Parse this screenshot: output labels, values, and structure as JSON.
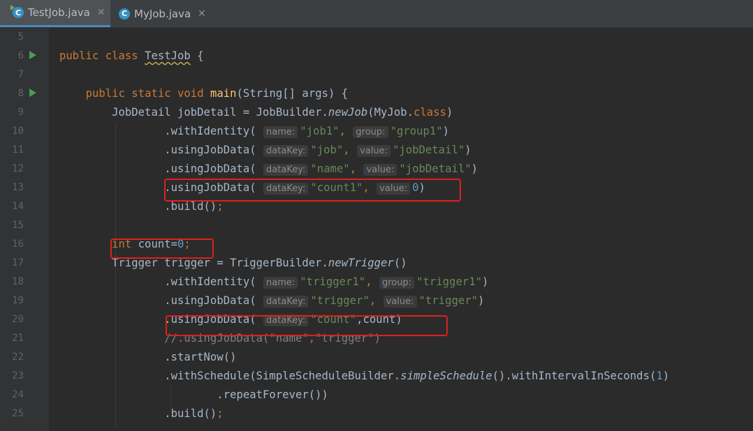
{
  "tabs": [
    {
      "label": "TestJob.java",
      "icon": "java-class-icon",
      "active": true
    },
    {
      "label": "MyJob.java",
      "icon": "java-class-icon",
      "active": false
    }
  ],
  "close_glyph": "✕",
  "class_icon_letter": "C",
  "line_numbers": [
    "5",
    "6",
    "7",
    "8",
    "9",
    "10",
    "11",
    "12",
    "13",
    "14",
    "15",
    "16",
    "17",
    "18",
    "19",
    "20",
    "21",
    "22",
    "23",
    "24",
    "25"
  ],
  "hints": {
    "name": "name:",
    "group": "group:",
    "dataKey": "dataKey:",
    "value": "value:"
  },
  "code": {
    "l6_public": "public",
    "l6_class": "class",
    "l6_name": "TestJob",
    "l6_brace": " {",
    "l8_public": "public",
    "l8_static": "static",
    "l8_void": "void",
    "l8_main": "main",
    "l8_rest": "(String[] args) {",
    "l9_a": "JobDetail jobDetail = JobBuilder.",
    "l9_newJob": "newJob",
    "l9_b": "(MyJob.",
    "l9_class": "class",
    "l9_c": ")",
    "l10_a": ".withIdentity(",
    "l10_s1": "\"job1\"",
    "l10_s2": "\"group1\"",
    "l10_end": ")",
    "l11_a": ".usingJobData(",
    "l11_s1": "\"job\"",
    "l11_s2": "\"jobDetail\"",
    "l11_end": ")",
    "l12_a": ".usingJobData(",
    "l12_s1": "\"name\"",
    "l12_s2": "\"jobDetail\"",
    "l12_end": ")",
    "l13_a": ".usingJobData(",
    "l13_s1": "\"count1\"",
    "l13_n": "0",
    "l13_end": ")",
    "l14_a": ".build()",
    "l14_semi": ";",
    "l16_int": "int",
    "l16_a": " count=",
    "l16_n": "0",
    "l16_semi": ";",
    "l17_a": "Trigger trigger = TriggerBuilder.",
    "l17_newTrigger": "newTrigger",
    "l17_b": "()",
    "l18_a": ".withIdentity(",
    "l18_s1": "\"trigger1\"",
    "l18_s2": "\"trigger1\"",
    "l18_end": ")",
    "l19_a": ".usingJobData(",
    "l19_s1": "\"trigger\"",
    "l19_s2": "\"trigger\"",
    "l19_end": ")",
    "l20_a": ".usingJobData(",
    "l20_s1": "\"count\"",
    "l20_b": ",count)",
    "l21_comment": "//.usingJobData(\"name\",\"trigger\")",
    "l22_a": ".startNow()",
    "l23_a": ".withSchedule(SimpleScheduleBuilder.",
    "l23_simple": "simpleSchedule",
    "l23_b": "().withIntervalInSeconds(",
    "l23_n": "1",
    "l23_end": ")",
    "l24_a": ".repeatForever())",
    "l25_a": ".build()",
    "l25_semi": ";"
  },
  "colors": {
    "keyword": "#cc7832",
    "string": "#6a8759",
    "number": "#6897bb",
    "method": "#ffc66d",
    "highlight_box": "#e0201a"
  }
}
